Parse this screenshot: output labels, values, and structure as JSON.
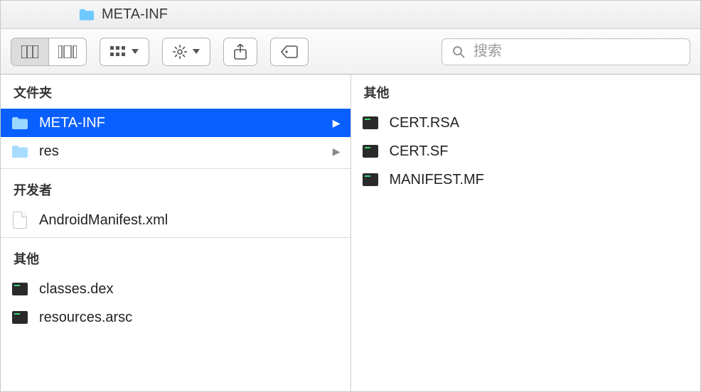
{
  "titlebar": {
    "title": "META-INF"
  },
  "toolbar": {
    "view_columns_icon": "columns-view-icon",
    "view_gallery_icon": "gallery-view-icon",
    "arrange_icon": "arrange-icon",
    "action_icon": "gear-icon",
    "share_icon": "share-icon",
    "tags_icon": "tags-icon",
    "search_icon": "search-icon",
    "search_placeholder": "搜索"
  },
  "left": {
    "sections": [
      {
        "header": "文件夹",
        "items": [
          {
            "name": "META-INF",
            "icon": "folder",
            "selected": true,
            "has_children": true
          },
          {
            "name": "res",
            "icon": "folder",
            "selected": false,
            "has_children": true
          }
        ]
      },
      {
        "header": "开发者",
        "items": [
          {
            "name": "AndroidManifest.xml",
            "icon": "doc",
            "selected": false,
            "has_children": false
          }
        ]
      },
      {
        "header": "其他",
        "items": [
          {
            "name": "classes.dex",
            "icon": "term",
            "selected": false,
            "has_children": false
          },
          {
            "name": "resources.arsc",
            "icon": "term",
            "selected": false,
            "has_children": false
          }
        ]
      }
    ]
  },
  "right": {
    "sections": [
      {
        "header": "其他",
        "items": [
          {
            "name": "CERT.RSA",
            "icon": "term"
          },
          {
            "name": "CERT.SF",
            "icon": "term"
          },
          {
            "name": "MANIFEST.MF",
            "icon": "term"
          }
        ]
      }
    ]
  }
}
